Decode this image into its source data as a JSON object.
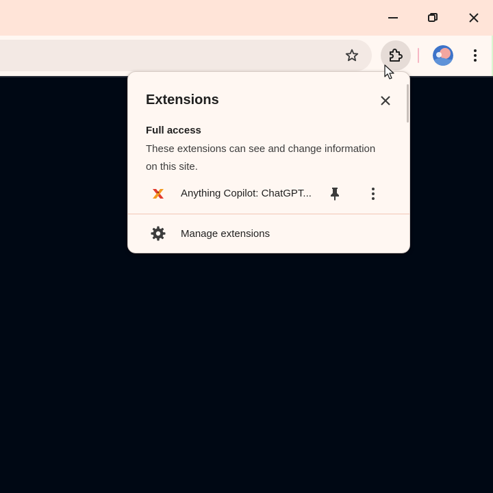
{
  "window": {
    "minimize_icon": "minimize-icon",
    "restore_icon": "restore-icon",
    "close_icon": "close-icon"
  },
  "toolbar": {
    "bookmark_icon": "star-icon",
    "extensions_icon": "puzzle-icon",
    "profile_icon": "avatar",
    "menu_icon": "kebab-icon"
  },
  "popup": {
    "title": "Extensions",
    "section_title": "Full access",
    "section_description": "These extensions can see and change information on this site.",
    "extensions": [
      {
        "name": "Anything Copilot: ChatGPT...",
        "icon": "anything-copilot-icon"
      }
    ],
    "manage_label": "Manage extensions"
  },
  "colors": {
    "titlebar": "#ffe4d8",
    "toolbar": "#fff7f2",
    "page_background": "#000814",
    "popup_background": "#fff7f2",
    "divider": "#f2c6b4"
  }
}
